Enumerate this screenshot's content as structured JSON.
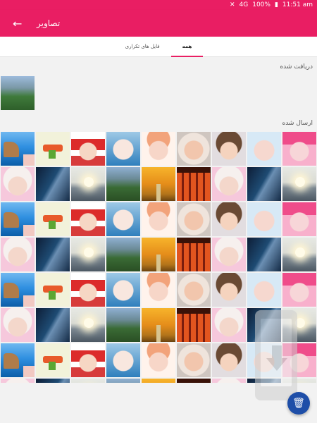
{
  "status": {
    "time": "11:51 am",
    "battery": "100%",
    "network": "4G"
  },
  "appbar": {
    "title": "تصاویر",
    "back_icon": "arrow-back-icon"
  },
  "tabs": [
    {
      "label": "فایل های تکراری",
      "active": false
    },
    {
      "label": "همه",
      "active": true
    }
  ],
  "sections": {
    "received": "دریافت شده",
    "sent": "ارسال شده"
  },
  "received_images": [
    "mountain-landscape"
  ],
  "sent_images_pattern": [
    [
      "coast",
      "doodle",
      "redcap",
      "girl-blue",
      "girl-flower",
      "hood",
      "curly",
      "pinkbaby",
      "pinkhat"
    ],
    [
      "bonnet",
      "milkyway",
      "sunrise",
      "mountain",
      "forest",
      "torii",
      "bonnet",
      "milkyway",
      "sunrise"
    ]
  ],
  "fab": {
    "icon": "trash-icon"
  },
  "colors": {
    "primary": "#e91e63",
    "fab": "#1e4ea8"
  }
}
